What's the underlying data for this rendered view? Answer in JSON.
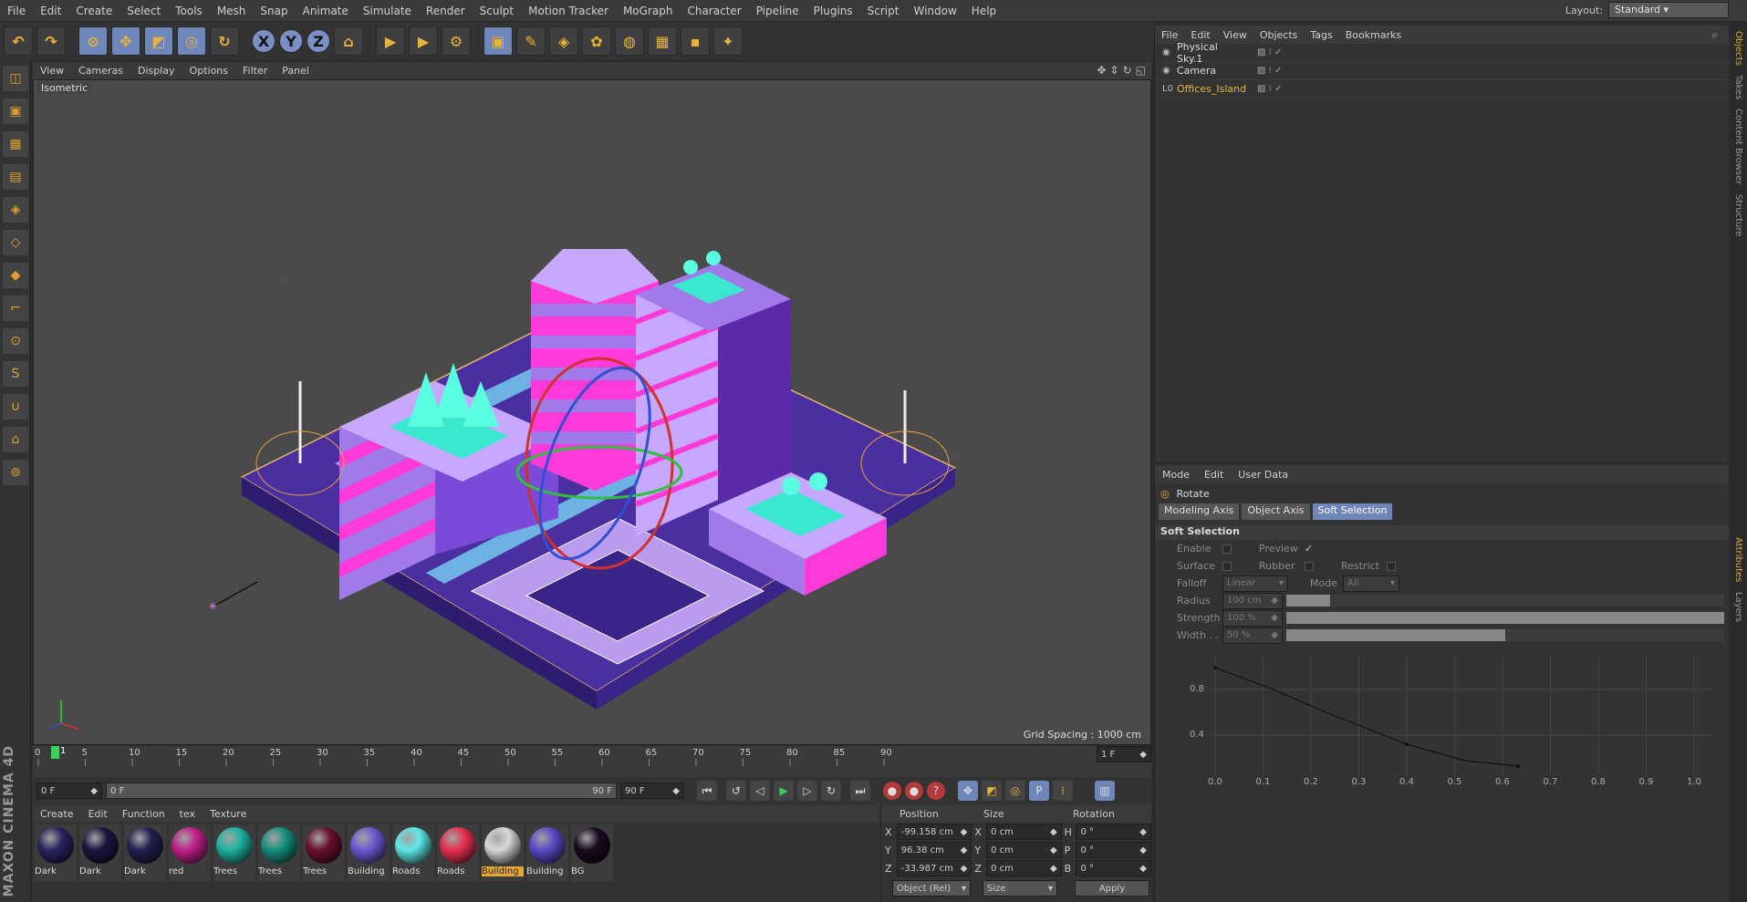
{
  "menubar": {
    "items": [
      "File",
      "Edit",
      "Create",
      "Select",
      "Tools",
      "Mesh",
      "Snap",
      "Animate",
      "Simulate",
      "Render",
      "Sculpt",
      "Motion Tracker",
      "MoGraph",
      "Character",
      "Pipeline",
      "Plugins",
      "Script",
      "Window",
      "Help"
    ],
    "layout_label": "Layout:",
    "layout_value": "Standard"
  },
  "toolbar": {
    "icons": [
      "undo-icon",
      "redo-icon",
      "live-selection-icon",
      "move-icon",
      "scale-icon",
      "rotate-icon",
      "recent-tool-icon",
      "x-axis-icon",
      "y-axis-icon",
      "z-axis-icon",
      "coordinate-system-icon",
      "render-view-icon",
      "render-picture-viewer-icon",
      "edit-render-settings-icon",
      "cube-icon",
      "pen-icon",
      "subdivision-icon",
      "cloner-icon",
      "deformer-icon",
      "floor-icon",
      "camera-icon",
      "light-icon"
    ],
    "axis_labels": [
      "X",
      "Y",
      "Z"
    ]
  },
  "viewport": {
    "menu": [
      "View",
      "Cameras",
      "Display",
      "Options",
      "Filter",
      "Panel"
    ],
    "label": "Isometric",
    "grid_spacing": "Grid Spacing : 1000 cm"
  },
  "timeline": {
    "ticks": [
      "0",
      "5",
      "10",
      "15",
      "20",
      "25",
      "30",
      "35",
      "40",
      "45",
      "50",
      "55",
      "60",
      "65",
      "70",
      "75",
      "80",
      "85",
      "90"
    ],
    "current_frame_marker": "1",
    "frame_field": "1 F",
    "start": "0 F",
    "range_start": "0 F",
    "range_end": "90 F",
    "end": "90 F"
  },
  "materials": {
    "menu": [
      "Create",
      "Edit",
      "Function",
      "tex",
      "Texture"
    ],
    "items": [
      {
        "name": "Dark",
        "color": "#2a2560"
      },
      {
        "name": "Dark",
        "color": "#1c1640"
      },
      {
        "name": "Dark",
        "color": "#232050"
      },
      {
        "name": "red",
        "color": "#c0208a"
      },
      {
        "name": "Trees",
        "color": "#1fb3a0"
      },
      {
        "name": "Trees",
        "color": "#17907e"
      },
      {
        "name": "Trees",
        "color": "#6a1030"
      },
      {
        "name": "Building",
        "color": "#6a5ad0"
      },
      {
        "name": "Roads",
        "color": "#5fe8e8"
      },
      {
        "name": "Roads",
        "color": "#e83050"
      },
      {
        "name": "Building",
        "color": "#d8d8d8"
      },
      {
        "name": "Building",
        "color": "#5a4ac8"
      },
      {
        "name": "BG",
        "color": "#1a0a20"
      }
    ],
    "active_index": 10
  },
  "coords": {
    "headers": [
      "Position",
      "Size",
      "Rotation"
    ],
    "rows": [
      {
        "axis": "X",
        "pos": "-99.158 cm",
        "size_axis": "X",
        "size": "0 cm",
        "rot_axis": "H",
        "rot": "0 °"
      },
      {
        "axis": "Y",
        "pos": "96.38 cm",
        "size_axis": "Y",
        "size": "0 cm",
        "rot_axis": "P",
        "rot": "0 °"
      },
      {
        "axis": "Z",
        "pos": "-33.987 cm",
        "size_axis": "Z",
        "size": "0 cm",
        "rot_axis": "B",
        "rot": "0 °"
      }
    ],
    "mode": "Object (Rel)",
    "size_mode": "Size",
    "apply": "Apply"
  },
  "objects": {
    "menu": [
      "File",
      "Edit",
      "View",
      "Objects",
      "Tags",
      "Bookmarks"
    ],
    "rows": [
      {
        "name": "Physical Sky.1",
        "icon": "sky-icon"
      },
      {
        "name": "Camera",
        "icon": "camera-icon"
      },
      {
        "name": "Offices_Island",
        "icon": "null-icon"
      }
    ]
  },
  "attributes": {
    "menu": [
      "Mode",
      "Edit",
      "User Data"
    ],
    "title": "Rotate",
    "tabs": [
      "Modeling Axis",
      "Object Axis",
      "Soft Selection"
    ],
    "active_tab": 2,
    "section": "Soft Selection",
    "enable": "Enable",
    "preview": "Preview",
    "preview_check": "✓",
    "surface": "Surface",
    "rubber": "Rubber",
    "restrict": "Restrict",
    "falloff_label": "Falloff",
    "falloff_value": "Linear",
    "mode_label": "Mode",
    "mode_value": "All",
    "radius_label": "Radius",
    "radius_value": "100 cm",
    "radius_fill": 0.1,
    "strength_label": "Strength",
    "strength_value": "100 %",
    "strength_fill": 1.0,
    "width_label": "Width . .",
    "width_value": "50 %",
    "width_fill": 0.5,
    "graph_y_ticks": [
      "0.8",
      "0.4"
    ],
    "graph_x_ticks": [
      "0.0",
      "0.1",
      "0.2",
      "0.3",
      "0.4",
      "0.5",
      "0.6",
      "0.7",
      "0.8",
      "0.9",
      "1.0"
    ]
  },
  "sidetabs": [
    "Objects",
    "Takes",
    "Content Browser",
    "Structure",
    "Attributes",
    "Layers"
  ],
  "brand": "MAXON CINEMA 4D"
}
